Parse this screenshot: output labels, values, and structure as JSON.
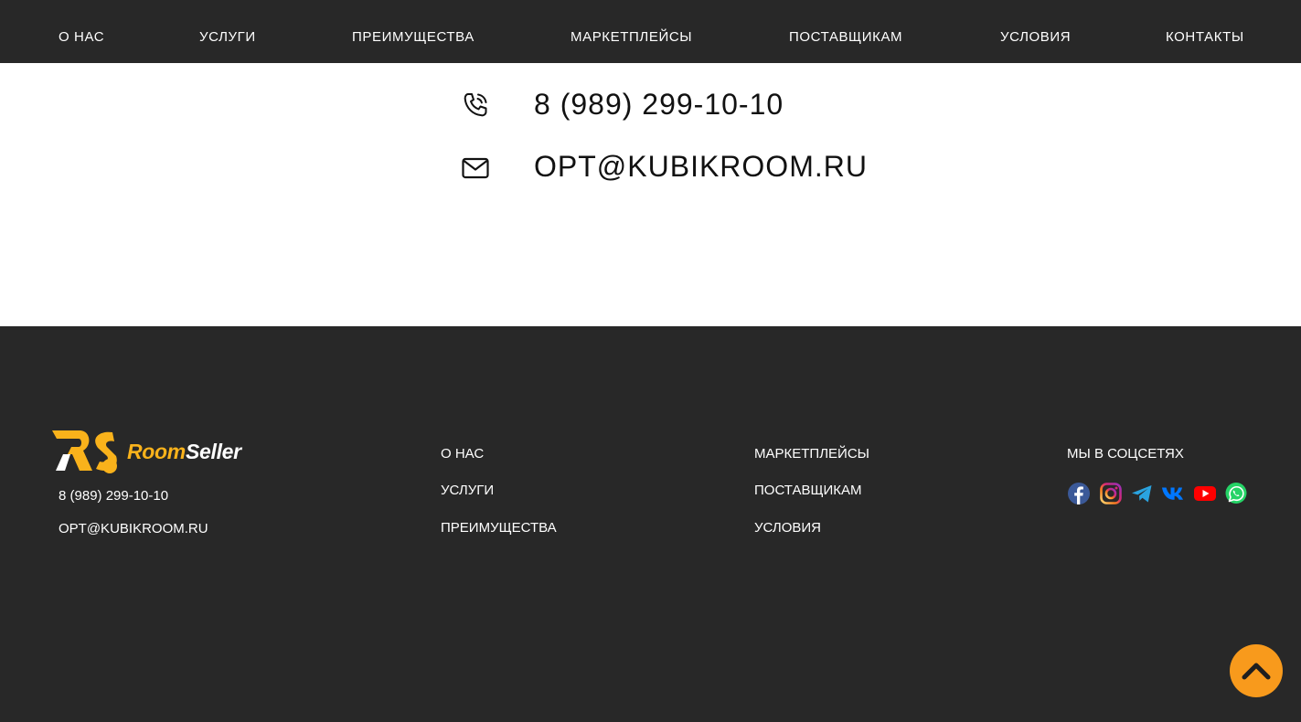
{
  "nav": {
    "items": [
      {
        "label": "О НАС"
      },
      {
        "label": "УСЛУГИ"
      },
      {
        "label": "ПРЕИМУЩЕСТВА"
      },
      {
        "label": "МАРКЕТПЛЕЙСЫ"
      },
      {
        "label": "ПОСТАВЩИКАМ"
      },
      {
        "label": "УСЛОВИЯ"
      },
      {
        "label": "КОНТАКТЫ"
      }
    ]
  },
  "contacts": {
    "phone": "8 (989) 299-10-10",
    "email": "OPT@KUBIKROOM.RU",
    "phone_icon": "phone-icon",
    "email_icon": "envelope-icon"
  },
  "footer": {
    "logo": {
      "mark": "RS",
      "word_part1": "Room",
      "word_part2": "Seller"
    },
    "phone": "8 (989) 299-10-10",
    "email": "OPT@KUBIKROOM.RU",
    "col1": [
      {
        "label": "О НАС"
      },
      {
        "label": "УСЛУГИ"
      },
      {
        "label": "ПРЕИМУЩЕСТВА"
      }
    ],
    "col2": [
      {
        "label": "МАРКЕТПЛЕЙСЫ"
      },
      {
        "label": "ПОСТАВЩИКАМ"
      },
      {
        "label": "УСЛОВИЯ"
      }
    ],
    "social_title": "МЫ В СОЦСЕТЯХ",
    "social": [
      {
        "icon": "facebook-icon",
        "color": "#3b5998"
      },
      {
        "icon": "instagram-icon",
        "color": "#e1306c"
      },
      {
        "icon": "telegram-icon",
        "color": "#2aa3df"
      },
      {
        "icon": "vk-icon",
        "color": "#0077ff"
      },
      {
        "icon": "youtube-icon",
        "color": "#ff0000"
      },
      {
        "icon": "whatsapp-icon",
        "color": "#25d366"
      }
    ]
  },
  "scroll_top": {
    "icon": "chevron-up-icon",
    "color": "#f89a1c"
  },
  "colors": {
    "dark": "#282828",
    "brand": "#f9b21b",
    "accent": "#f89a1c"
  }
}
